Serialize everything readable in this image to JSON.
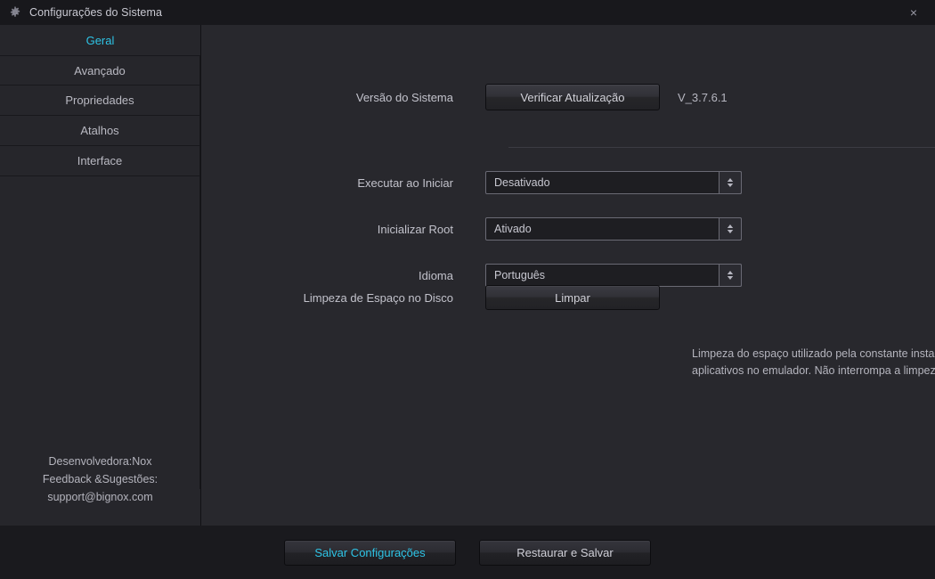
{
  "window": {
    "title": "Configurações do Sistema",
    "gear_icon": "gear-icon",
    "close_icon": "×"
  },
  "sidebar": {
    "items": [
      {
        "label": "Geral",
        "active": true
      },
      {
        "label": "Avançado",
        "active": false
      },
      {
        "label": "Propriedades",
        "active": false
      },
      {
        "label": "Atalhos",
        "active": false
      },
      {
        "label": "Interface",
        "active": false
      }
    ],
    "footer": {
      "line1": "Desenvolvedora:Nox",
      "line2": "Feedback &Sugestões:",
      "line3": "support@bignox.com"
    }
  },
  "main": {
    "system_version": {
      "label": "Versão do Sistema",
      "button_label": "Verificar Atualização",
      "value": "V_3.7.6.1"
    },
    "run_on_start": {
      "label": "Executar ao Iniciar",
      "value": "Desativado"
    },
    "init_root": {
      "label": "Inicializar Root",
      "value": "Ativado"
    },
    "language": {
      "label": "Idioma",
      "value": "Português"
    },
    "disk_cleanup": {
      "label": "Limpeza de Espaço no Disco",
      "button_label": "Limpar",
      "description": "Limpeza do espaço utilizado pela constante instalação/desinstalação de aplicativos no emulador. Não interrompa a limpeza para evitar erros."
    }
  },
  "footer": {
    "save_label": "Salvar Configurações",
    "restore_label": "Restaurar e Salvar"
  },
  "colors": {
    "accent": "#2ec4e6",
    "window_bg": "#1a1a1e",
    "sidebar_bg": "#26262b",
    "main_bg": "#28282d",
    "text": "#c2c2cb"
  }
}
